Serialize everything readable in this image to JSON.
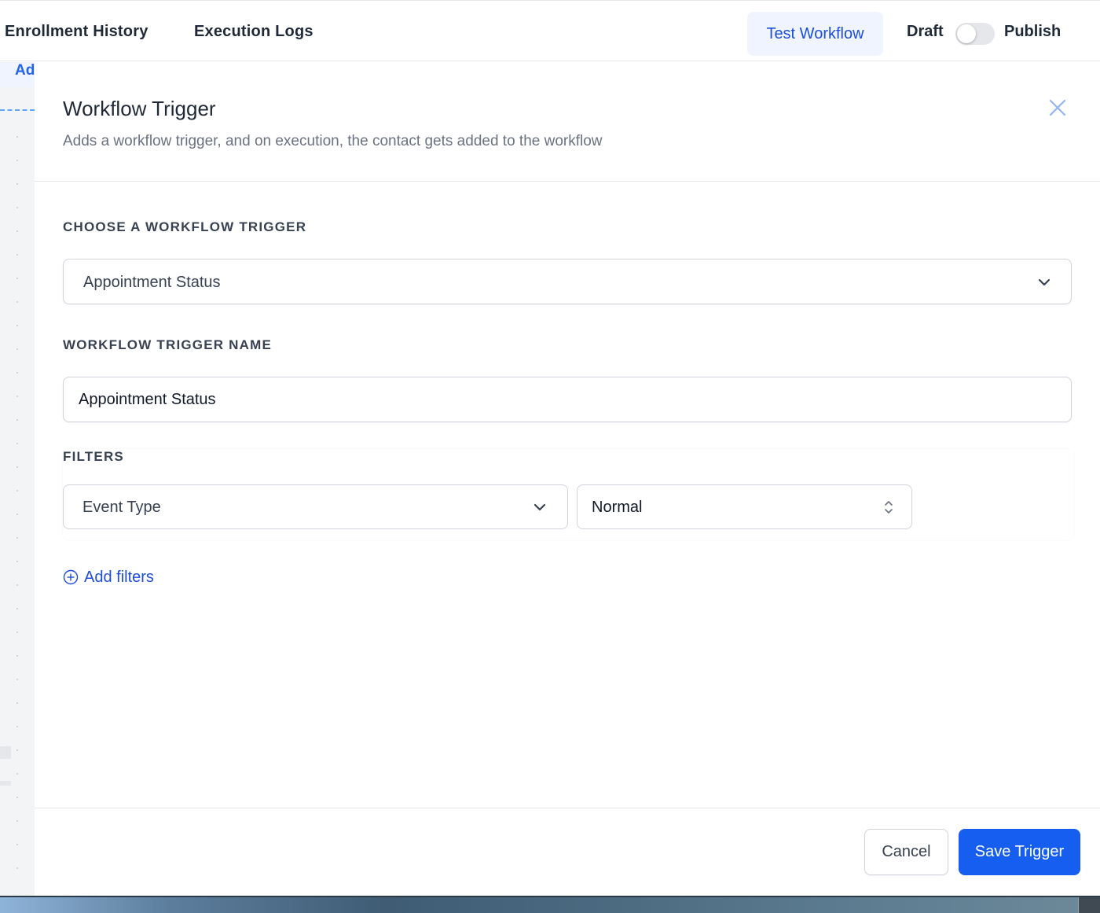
{
  "header": {
    "tabs": [
      {
        "label": "Enrollment History"
      },
      {
        "label": "Execution Logs"
      }
    ],
    "test_workflow_label": "Test Workflow",
    "draft_label": "Draft",
    "publish_label": "Publish",
    "toggle_on": false
  },
  "background": {
    "partial_label": "Ad"
  },
  "drawer": {
    "title": "Workflow Trigger",
    "subtitle": "Adds a workflow trigger, and on execution, the contact gets added to the workflow",
    "choose_trigger_label": "CHOOSE A WORKFLOW TRIGGER",
    "trigger_select_value": "Appointment Status",
    "trigger_name_label": "WORKFLOW TRIGGER NAME",
    "trigger_name_value": "Appointment Status",
    "filters_label": "FILTERS",
    "filter_field_value": "Event Type",
    "filter_value": "Normal",
    "add_filters_label": "Add filters",
    "cancel_label": "Cancel",
    "save_label": "Save Trigger"
  },
  "colors": {
    "accent": "#155eef",
    "link": "#1d4ed8",
    "test_button_bg": "#eff4ff"
  }
}
